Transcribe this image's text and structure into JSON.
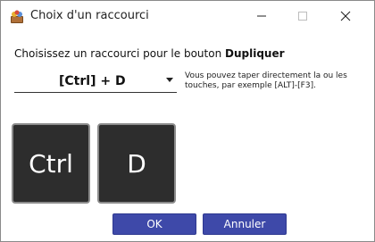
{
  "window": {
    "title": "Choix d'un raccourci",
    "icon": "app-icon",
    "controls": {
      "minimize_icon": "minimize-icon",
      "maximize_icon": "maximize-icon",
      "close_icon": "close-icon"
    }
  },
  "prompt": {
    "text": "Choisissez un raccourci pour le bouton ",
    "target": "Dupliquer"
  },
  "shortcut": {
    "selected": "[Ctrl] + D",
    "help": "Vous pouvez taper directement la ou les touches, par exemple [ALT]-[F3]."
  },
  "keys": [
    "Ctrl",
    "D"
  ],
  "buttons": {
    "ok": "OK",
    "cancel": "Annuler"
  },
  "colors": {
    "button_bg": "#3e49a9",
    "key_bg": "#2d2d2d"
  }
}
